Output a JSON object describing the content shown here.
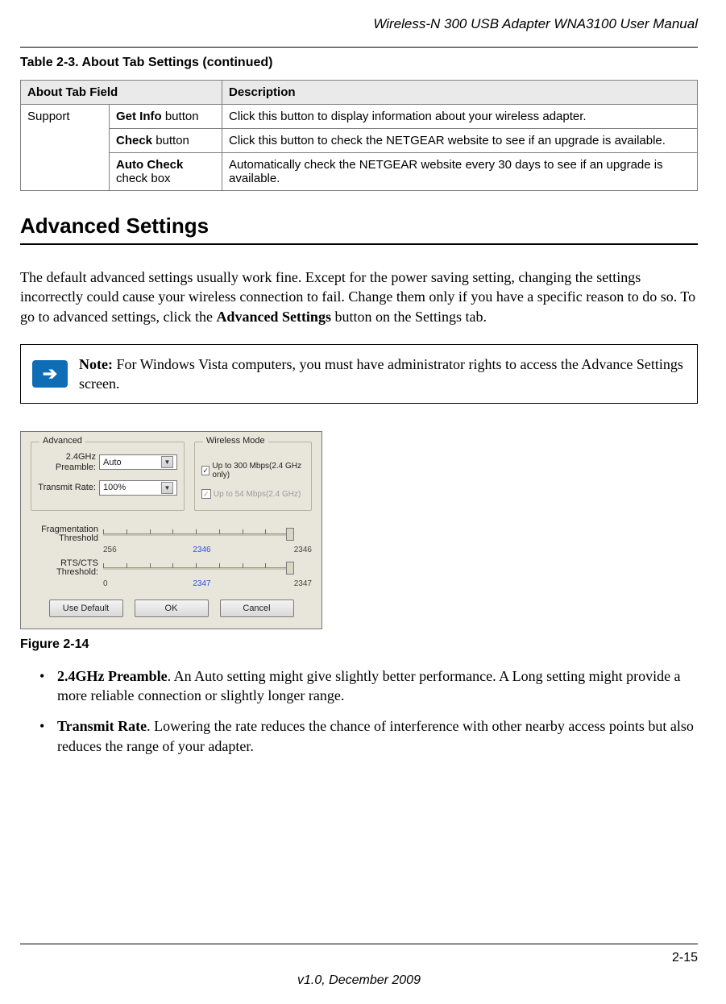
{
  "header_title": "Wireless-N 300 USB Adapter WNA3100 User Manual",
  "table_caption": "Table 2-3.   About Tab Settings  (continued)",
  "table": {
    "head": {
      "col1": "About Tab Field",
      "col2": "Description"
    },
    "group_label": "Support",
    "rows": [
      {
        "field_bold": "Get Info",
        "field_rest": " button",
        "desc": "Click this button to display information about your wireless adapter."
      },
      {
        "field_bold": "Check",
        "field_rest": " button",
        "desc": "Click this button to check the NETGEAR website to see if an upgrade is available."
      },
      {
        "field_bold": "Auto Check",
        "field_rest": " check box",
        "desc": "Automatically check the NETGEAR website every 30 days to see if an upgrade is available."
      }
    ]
  },
  "section_heading": "Advanced Settings",
  "paragraph_pre": "The default advanced settings usually work fine. Except for the power saving setting, changing the settings incorrectly could cause your wireless connection to fail. Change them only if you have a specific reason to do so. To go to advanced settings, click the ",
  "paragraph_bold": "Advanced Settings",
  "paragraph_post": " button on the Settings tab.",
  "note_bold": "Note:",
  "note_text": " For Windows Vista computers, you must have administrator rights to access the Advance Settings screen.",
  "dialog": {
    "adv_legend": "Advanced",
    "mode_legend": "Wireless Mode",
    "preamble_label": "2.4GHz Preamble:",
    "preamble_value": "Auto",
    "tx_label": "Transmit Rate:",
    "tx_value": "100%",
    "mode_opt1": "Up to 300 Mbps(2.4 GHz only)",
    "mode_opt2": "Up to 54 Mbps(2.4 GHz)",
    "frag_label": "Fragmentation Threshold",
    "frag_min": "256",
    "frag_val": "2346",
    "frag_max": "2346",
    "rts_label": "RTS/CTS Threshold:",
    "rts_min": "0",
    "rts_val": "2347",
    "rts_max": "2347",
    "btn_default": "Use Default",
    "btn_ok": "OK",
    "btn_cancel": "Cancel"
  },
  "figure_caption": "Figure 2-14",
  "bullets": [
    {
      "bold": "2.4GHz Preamble",
      "rest": ". An Auto setting might give slightly better performance. A Long setting might provide a more reliable connection or slightly longer range."
    },
    {
      "bold": "Transmit Rate",
      "rest": ". Lowering the rate reduces the chance of interference with other nearby access points but also reduces the range of your adapter."
    }
  ],
  "page_number": "2-15",
  "version": "v1.0, December 2009"
}
